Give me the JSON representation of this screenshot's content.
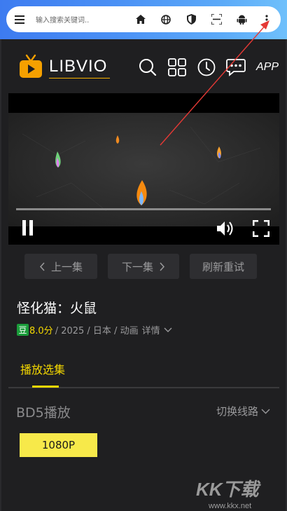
{
  "browser": {
    "url_placeholder": "输入搜索关键词..",
    "icons": [
      "menu-icon",
      "home-icon",
      "globe-icon",
      "shield-icon",
      "scan-icon",
      "android-icon",
      "more-vert-icon"
    ]
  },
  "header": {
    "logo_text": "LIBVIO",
    "app_label": "APP",
    "icons": [
      "search-icon",
      "grid-icon",
      "history-icon",
      "message-icon"
    ]
  },
  "player": {
    "progress": 0.0,
    "controls": [
      "pause-icon",
      "volume-icon",
      "fullscreen-icon"
    ]
  },
  "episode_nav": {
    "prev": "上一集",
    "next": "下一集",
    "refresh": "刷新重试"
  },
  "show": {
    "title": "怪化猫：火鼠",
    "douban_badge": "豆",
    "score": "8.0分",
    "meta": "/ 2025 / 日本 / 动画",
    "details": "详情"
  },
  "tabs": {
    "active": "播放选集"
  },
  "source": {
    "title": "BD5播放",
    "switch_label": "切换线路",
    "qualities": [
      "1080P"
    ]
  },
  "watermark": {
    "text": "KK下载",
    "url": "www.kkx.net"
  },
  "colors": {
    "accent": "#f5d800",
    "quality_button": "#f7e94a",
    "douban": "#1a9c3a",
    "annotation": "#e53935"
  }
}
